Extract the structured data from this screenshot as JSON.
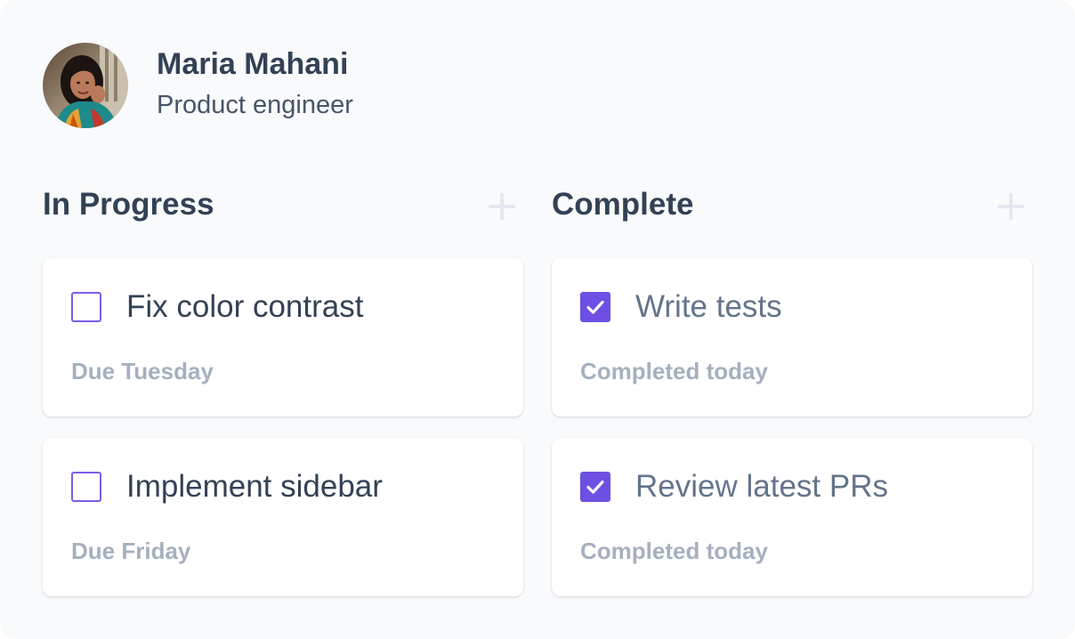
{
  "profile": {
    "name": "Maria Mahani",
    "role": "Product engineer"
  },
  "columns": [
    {
      "title": "In Progress",
      "add_icon": "plus-icon",
      "tasks": [
        {
          "title": "Fix color contrast",
          "meta": "Due Tuesday",
          "checked": false
        },
        {
          "title": "Implement sidebar",
          "meta": "Due Friday",
          "checked": false
        }
      ]
    },
    {
      "title": "Complete",
      "add_icon": "plus-icon",
      "tasks": [
        {
          "title": "Write tests",
          "meta": "Completed today",
          "checked": true
        },
        {
          "title": "Review latest PRs",
          "meta": "Completed today",
          "checked": true
        }
      ]
    }
  ],
  "colors": {
    "accent": "#6d4fe3",
    "heading": "#334155",
    "muted": "#a5b0bf",
    "background": "#f8fafc"
  }
}
